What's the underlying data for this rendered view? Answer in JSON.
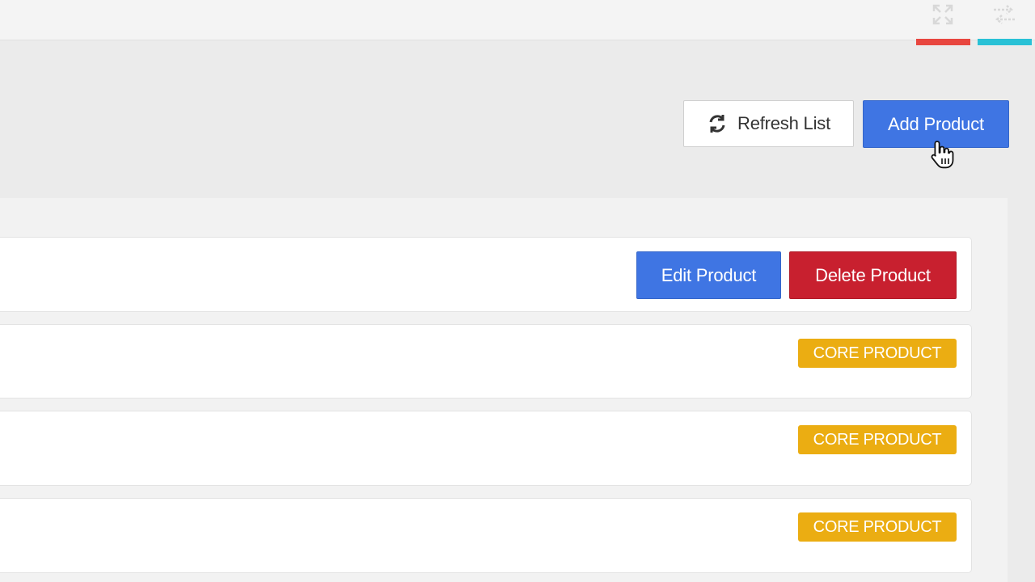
{
  "topbar": {
    "icons": [
      "expand-icon",
      "swap-arrows-icon"
    ],
    "accent_red": "#e8463f",
    "accent_cyan": "#29c1d6"
  },
  "toolbar": {
    "refresh_label": "Refresh List",
    "add_label": "Add Product",
    "refresh_icon": "refresh-icon"
  },
  "rows": [
    {
      "edit_label": "Edit Product",
      "delete_label": "Delete Product"
    },
    {
      "badge": "CORE PRODUCT"
    },
    {
      "badge": "CORE PRODUCT"
    },
    {
      "badge": "CORE PRODUCT"
    }
  ],
  "colors": {
    "primary": "#3f75e3",
    "danger": "#c8202f",
    "warning": "#ebad12"
  }
}
